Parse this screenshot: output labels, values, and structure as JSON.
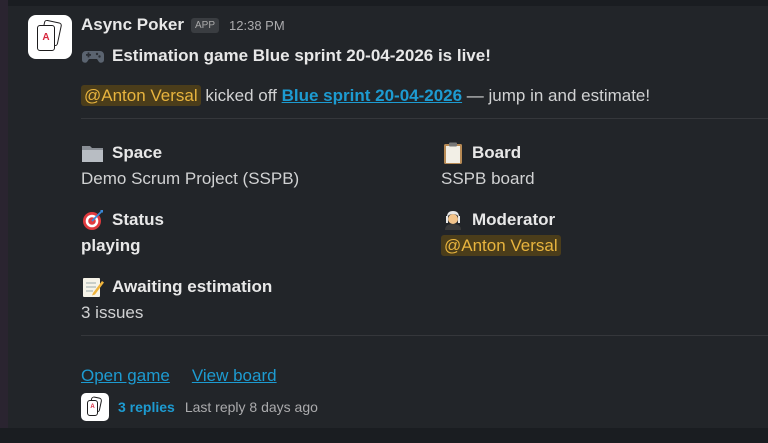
{
  "message": {
    "bot_name": "Async Poker",
    "app_badge": "APP",
    "time": "12:38 PM",
    "avatar_letter": "A",
    "title": "Estimation game Blue sprint 20-04-2026 is live!",
    "intro": {
      "mention": "@Anton Versal",
      "text_before_link": " kicked off ",
      "link_text": "Blue sprint 20-04-2026",
      "text_after_link": " — jump in and estimate!"
    },
    "fields": {
      "space": {
        "label": "Space",
        "value": "Demo Scrum Project (SSPB)",
        "icon": "folder-icon"
      },
      "board": {
        "label": "Board",
        "value": "SSPB board",
        "icon": "clipboard-icon"
      },
      "status": {
        "label": "Status",
        "value": "playing",
        "icon": "target-icon"
      },
      "moderator": {
        "label": "Moderator",
        "value": "@Anton Versal",
        "icon": "judge-icon"
      },
      "awaiting": {
        "label": "Awaiting estimation",
        "value": "3 issues",
        "icon": "memo-icon"
      }
    },
    "actions": {
      "open_game": "Open game",
      "view_board": "View board"
    },
    "thread": {
      "replies": "3 replies",
      "last_reply": "Last reply 8 days ago"
    }
  },
  "colors": {
    "background": "#1a1d21",
    "message_bg": "#222529",
    "link": "#1d9bd1",
    "mention_bg": "#4b3d1a",
    "mention_fg": "#e8b43e"
  }
}
